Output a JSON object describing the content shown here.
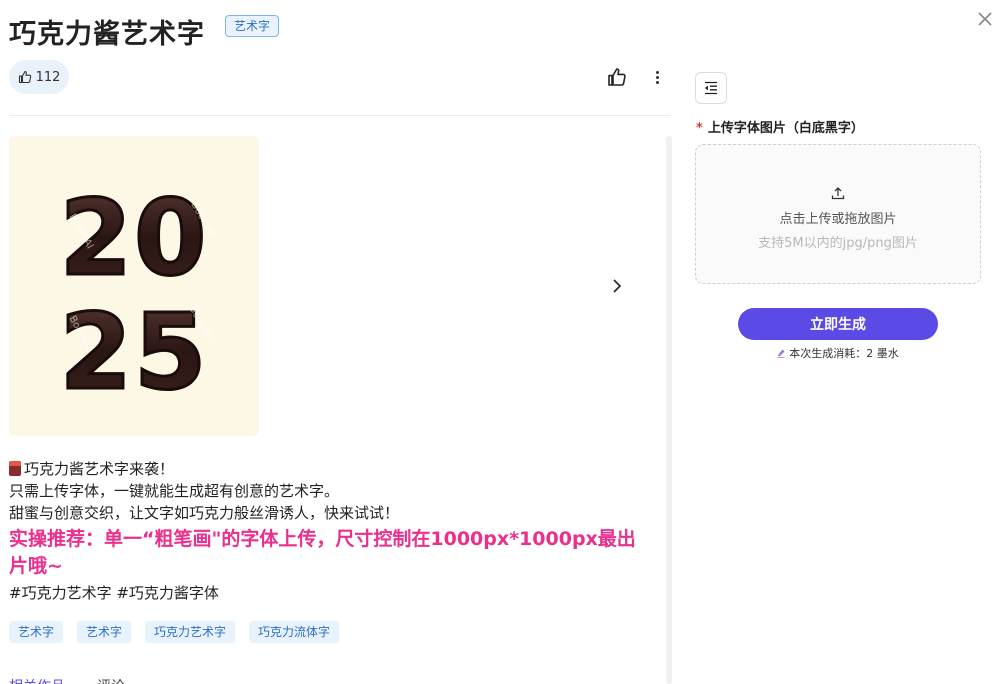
{
  "header": {
    "title": "巧克力酱艺术字",
    "badge": "艺术字",
    "close_glyph": "✕"
  },
  "actions": {
    "like_count": "112",
    "like_icon": "thumb-up-icon",
    "more_icon": "more-vertical-icon"
  },
  "gallery": {
    "image_text_top": "20",
    "image_text_bottom": "25",
    "watermark": "BoomAI",
    "next_icon": "chevron-right-icon"
  },
  "description": {
    "line1": "巧克力酱艺术字来袭！",
    "line2": "只需上传字体，一键就能生成超有创意的艺术字。",
    "line3": "甜蜜与创意交织，让文字如巧克力般丝滑诱人，快来试试！",
    "highlight": "实操推荐：单一“粗笔画\"的字体上传，尺寸控制在1000px*1000px最出片哦~",
    "hashtags": "#巧克力艺术字 #巧克力酱字体"
  },
  "tags": [
    "艺术字",
    "艺术字",
    "巧克力艺术字",
    "巧克力流体字"
  ],
  "bottom_tabs": [
    "相关作品",
    "评论"
  ],
  "panel": {
    "required_mark": "*",
    "field_label": "上传字体图片（白底黑字）",
    "upload_main": "点击上传或拖放图片",
    "upload_sub": "支持5M以内的jpg/png图片",
    "generate_button": "立即生成",
    "cost_text": "本次生成消耗：2 墨水"
  },
  "colors": {
    "accent": "#5b4ae6",
    "highlight": "#ea2f8c",
    "tag_bg": "#e8f2fc",
    "tag_text": "#2b6fc7",
    "hero_bg": "#fdf8e6"
  }
}
